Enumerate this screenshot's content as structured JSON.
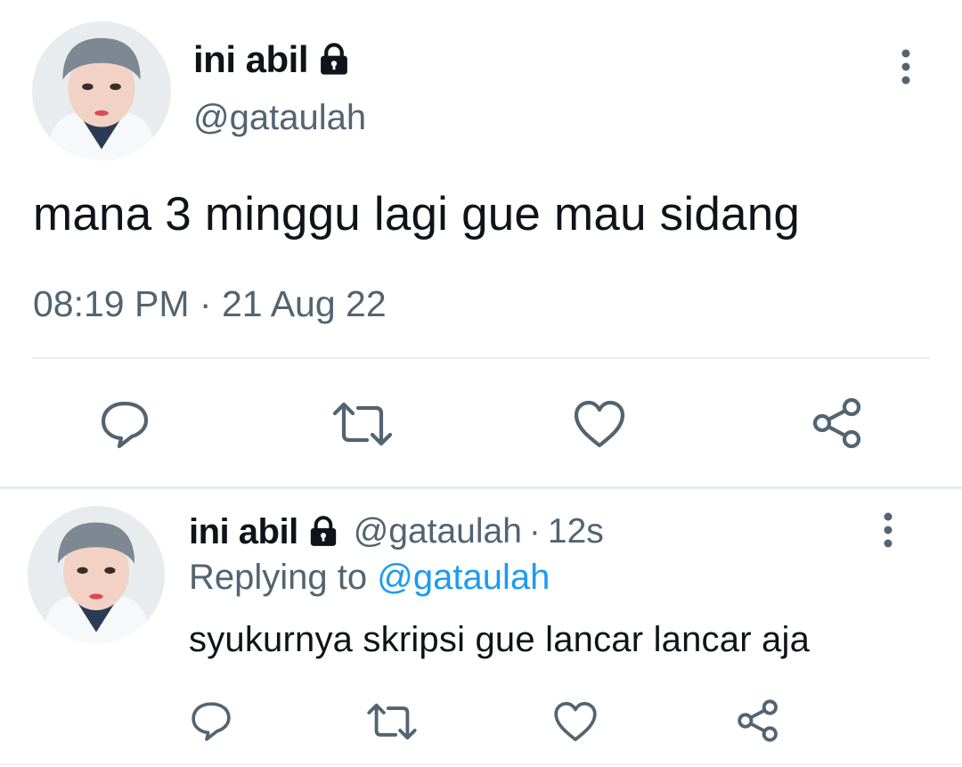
{
  "main_tweet": {
    "display_name": "ini abil",
    "handle": "@gataulah",
    "text": "mana 3 minggu lagi gue mau sidang",
    "time": "08:19 PM",
    "separator": "·",
    "date": "21 Aug 22"
  },
  "reply_tweet": {
    "display_name": "ini abil",
    "handle": "@gataulah",
    "separator": "·",
    "time_ago": "12s",
    "replying_prefix": "Replying to",
    "replying_to": "@gataulah",
    "text": "syukurnya skripsi gue lancar lancar aja"
  },
  "icons": {
    "lock": "lock-icon",
    "more": "more-vertical-icon",
    "reply": "reply-icon",
    "retweet": "retweet-icon",
    "like": "heart-icon",
    "share": "share-icon"
  },
  "colors": {
    "text_primary": "#0f1419",
    "text_secondary": "#536471",
    "accent": "#1d9bf0",
    "divider": "#e6ecf0"
  }
}
